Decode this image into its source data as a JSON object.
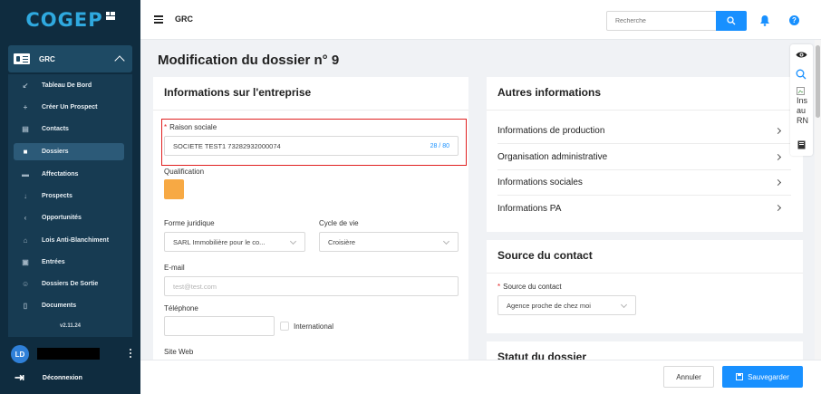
{
  "brand": {
    "logo_text": "COGEP",
    "accent": "#2fa9df"
  },
  "sidebar": {
    "module": {
      "label": "GRC",
      "icon": "id-card-icon"
    },
    "items": [
      {
        "label": "Tableau De Bord",
        "icon": "chart-line-icon"
      },
      {
        "label": "Créer Un Prospect",
        "icon": "plus-icon"
      },
      {
        "label": "Contacts",
        "icon": "contact-card-icon"
      },
      {
        "label": "Dossiers",
        "icon": "folder-icon",
        "active": true
      },
      {
        "label": "Affectations",
        "icon": "briefcase-icon"
      },
      {
        "label": "Prospects",
        "icon": "user-download-icon"
      },
      {
        "label": "Opportunités",
        "icon": "chevron-left-icon"
      },
      {
        "label": "Lois Anti-Blanchiment",
        "icon": "bank-icon"
      },
      {
        "label": "Entrées",
        "icon": "inbox-icon"
      },
      {
        "label": "Dossiers De Sortie",
        "icon": "user-exit-icon"
      },
      {
        "label": "Documents",
        "icon": "document-icon"
      }
    ],
    "version": "v2.11.24",
    "user": {
      "initials": "LD"
    },
    "logout_label": "Déconnexion"
  },
  "topbar": {
    "title": "GRC",
    "search_placeholder": "Recherche",
    "help_glyph": "?"
  },
  "page": {
    "title": "Modification du dossier n° 9"
  },
  "company": {
    "title": "Informations sur l'entreprise",
    "raison_sociale": {
      "label": "Raison sociale",
      "value": "SOCIETE TEST1 73282932000074",
      "counter": "28 / 80"
    },
    "qualification": {
      "label": "Qualification",
      "color": "#f7a944"
    },
    "forme_juridique": {
      "label": "Forme juridique",
      "value": "SARL Immobilière pour le co..."
    },
    "cycle_de_vie": {
      "label": "Cycle de vie",
      "value": "Croisière"
    },
    "email": {
      "label": "E-mail",
      "placeholder": "test@test.com"
    },
    "telephone": {
      "label": "Téléphone",
      "international_label": "International"
    },
    "site_web": {
      "label": "Site Web"
    }
  },
  "other_info": {
    "title": "Autres informations",
    "items": [
      "Informations de production",
      "Organisation administrative",
      "Informations sociales",
      "Informations PA"
    ]
  },
  "source": {
    "title": "Source du contact",
    "field_label": "Source du contact",
    "value": "Agence proche de chez moi"
  },
  "statut": {
    "title": "Statut du dossier"
  },
  "rail": {
    "broken_image_text": "Ins au RN"
  },
  "footer": {
    "cancel_label": "Annuler",
    "save_label": "Sauvegarder"
  }
}
